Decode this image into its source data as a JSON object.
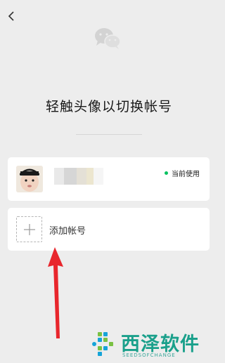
{
  "header": {
    "back_icon": "chevron-left-icon"
  },
  "logo": {
    "icon": "wechat-logo-icon"
  },
  "title": "轻触头像以切换帐号",
  "accounts": [
    {
      "name": "",
      "status": "当前使用",
      "status_color": "#07c160"
    }
  ],
  "add_account": {
    "label": "添加帐号",
    "icon": "plus-icon"
  },
  "watermark": {
    "title": "西泽软件",
    "subtitle": "SEEDSOFCHANGE"
  },
  "colors": {
    "background": "#ededed",
    "card": "#ffffff",
    "accent": "#07c160",
    "arrow": "#e8262c"
  }
}
